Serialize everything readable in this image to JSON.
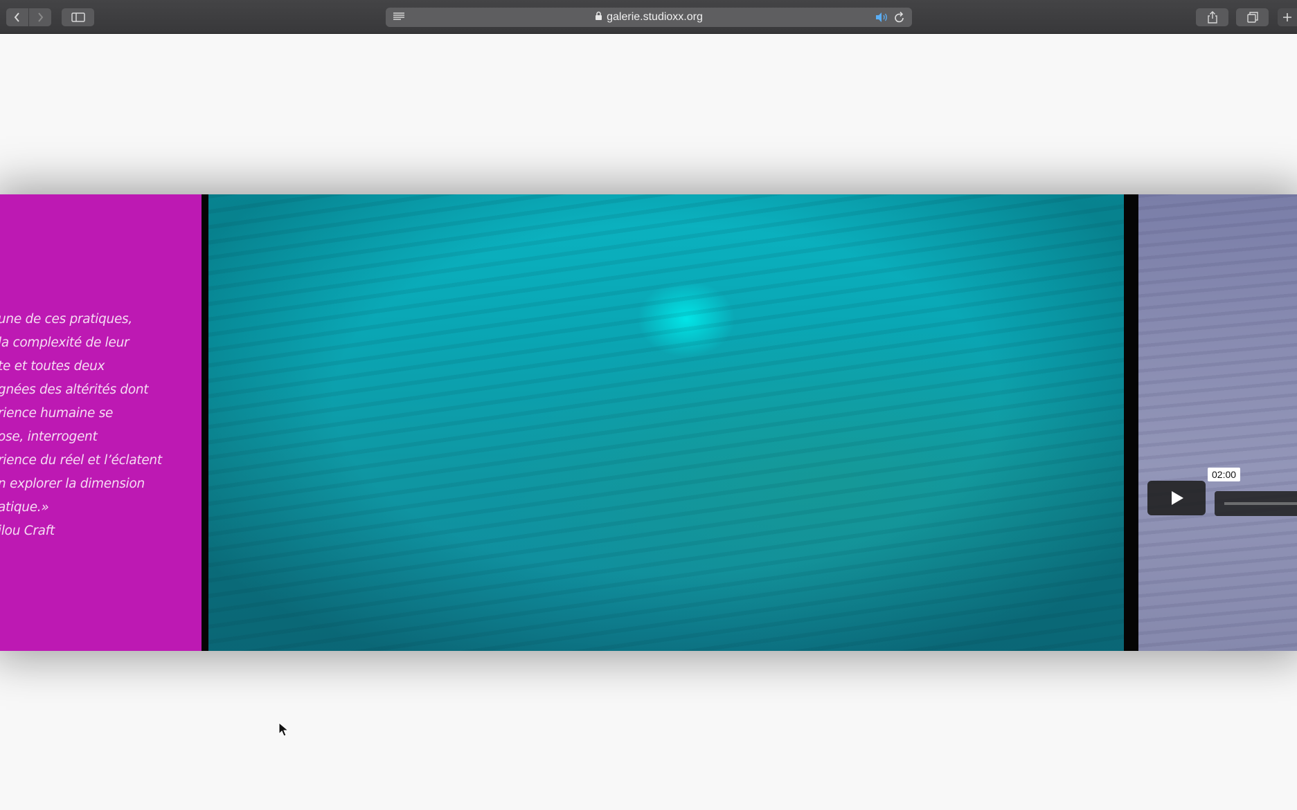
{
  "browser": {
    "url": "galerie.studioxx.org",
    "icons": {
      "back": "chevron-left-icon",
      "forward": "chevron-right-icon",
      "sidebar": "sidebar-icon",
      "reader": "reader-icon",
      "lock": "lock-icon",
      "audio": "speaker-icon",
      "reload": "reload-icon",
      "share": "share-icon",
      "tabs": "tabs-icon",
      "new_tab": "plus-icon"
    },
    "audio_color": "#5aaef5"
  },
  "gallery": {
    "quote_lines": [
      "une de ces pratiques,",
      " la complexité de leur",
      "te et toutes deux",
      "gnées des altérités dont",
      "rience humaine se",
      "ose, interrogent",
      "rience du réel et l’éclatent",
      "n explorer la dimension",
      "atique.»",
      "ilou Craft"
    ],
    "panel_color": "#bd19b3",
    "video_colors": {
      "main": "#0aa6b4",
      "right": "#8a8db2"
    },
    "video_controls": {
      "duration": "02:00",
      "play_icon": "play-icon"
    }
  }
}
